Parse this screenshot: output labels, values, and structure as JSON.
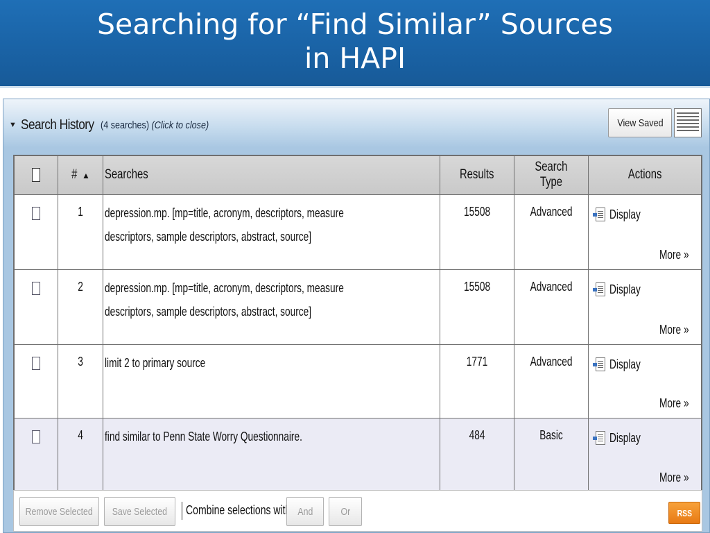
{
  "slide": {
    "title_line1": "Searching for “Find Similar” Sources",
    "title_line2": "in HAPI"
  },
  "history": {
    "toggle_glyph": "▼",
    "title": "Search History",
    "count_text": "(4 searches)",
    "click_text": "(Click to close)",
    "view_saved_label": "View Saved",
    "list_icon": "list-lines-icon"
  },
  "table": {
    "headers": {
      "number": "#",
      "sort_glyph": "▲",
      "searches": "Searches",
      "results": "Results",
      "search_type": "Search Type",
      "actions": "Actions"
    },
    "rows": [
      {
        "num": "1",
        "search_line1": "depression.mp. [mp=title, acronym, descriptors, measure",
        "search_line2": "descriptors, sample descriptors, abstract, source]",
        "results": "15508",
        "type": "Advanced",
        "display": "Display",
        "more": "More »"
      },
      {
        "num": "2",
        "search_line1": "depression.mp. [mp=title, acronym, descriptors, measure",
        "search_line2": "descriptors, sample descriptors, abstract, source]",
        "results": "15508",
        "type": "Advanced",
        "display": "Display",
        "more": "More »"
      },
      {
        "num": "3",
        "search_line1": "limit 2 to primary source",
        "search_line2": "",
        "results": "1771",
        "type": "Advanced",
        "display": "Display",
        "more": "More »"
      },
      {
        "num": "4",
        "search_line1": "find similar to Penn State Worry Questionnaire.",
        "search_line2": "",
        "results": "484",
        "type": "Basic",
        "display": "Display",
        "more": "More »"
      }
    ]
  },
  "footer": {
    "remove_selected": "Remove Selected",
    "save_selected": "Save Selected",
    "combine_label": "Combine selections with:",
    "and_label": "And",
    "or_label": "Or",
    "rss_label": "RSS"
  },
  "colors": {
    "banner": "#1a63a6",
    "panel": "#a9c7e2",
    "link_blue": "#2a63b8",
    "rss_orange": "#e87a14"
  }
}
